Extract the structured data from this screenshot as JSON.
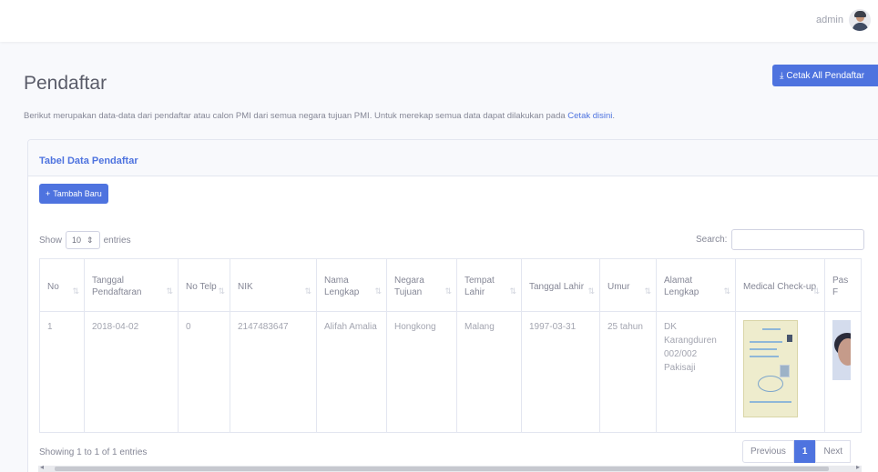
{
  "user": {
    "name": "admin"
  },
  "page": {
    "title": "Pendaftar",
    "print_all_label": "Cetak All Pendaftar",
    "description_prefix": "Berikut merupakan data-data dari pendaftar atau calon PMI dari semua negara tujuan PMI. Untuk merekap semua data dapat dilakukan pada",
    "description_link": "Cetak disini",
    "description_suffix": "."
  },
  "card": {
    "title": "Tabel Data Pendaftar",
    "add_button_label": "Tambah Baru"
  },
  "table_controls": {
    "show_label": "Show",
    "entries_value": "10",
    "entries_label": "entries",
    "search_label": "Search:"
  },
  "table": {
    "headers": [
      {
        "label": "No",
        "sort": "⇅"
      },
      {
        "label": "Tanggal Pendaftaran",
        "sort": "⇅"
      },
      {
        "label": "No Telp",
        "sort": "⇅"
      },
      {
        "label": "NIK",
        "sort": "⇅"
      },
      {
        "label": "Nama Lengkap",
        "sort": "⇅"
      },
      {
        "label": "Negara Tujuan",
        "sort": "⇅"
      },
      {
        "label": "Tempat Lahir",
        "sort": "⇅"
      },
      {
        "label": "Tanggal Lahir",
        "sort": "⇅"
      },
      {
        "label": "Umur",
        "sort": "⇅"
      },
      {
        "label": "Alamat Lengkap",
        "sort": "⇅"
      },
      {
        "label": "Medical Check-up",
        "sort": "⇅"
      },
      {
        "label": "Pas F",
        "sort": ""
      }
    ],
    "rows": [
      {
        "no": "1",
        "tanggal_pendaftaran": "2018-04-02",
        "no_telp": "0",
        "nik": "2147483647",
        "nama_lengkap": "Alifah Amalia",
        "negara_tujuan": "Hongkong",
        "tempat_lahir": "Malang",
        "tanggal_lahir": "1997-03-31",
        "umur": "25 tahun",
        "alamat_lengkap": "DK Karangduren 002/002 Pakisaji"
      }
    ]
  },
  "footer": {
    "info": "Showing 1 to 1 of 1 entries",
    "previous_label": "Previous",
    "current_page": "1",
    "next_label": "Next"
  }
}
